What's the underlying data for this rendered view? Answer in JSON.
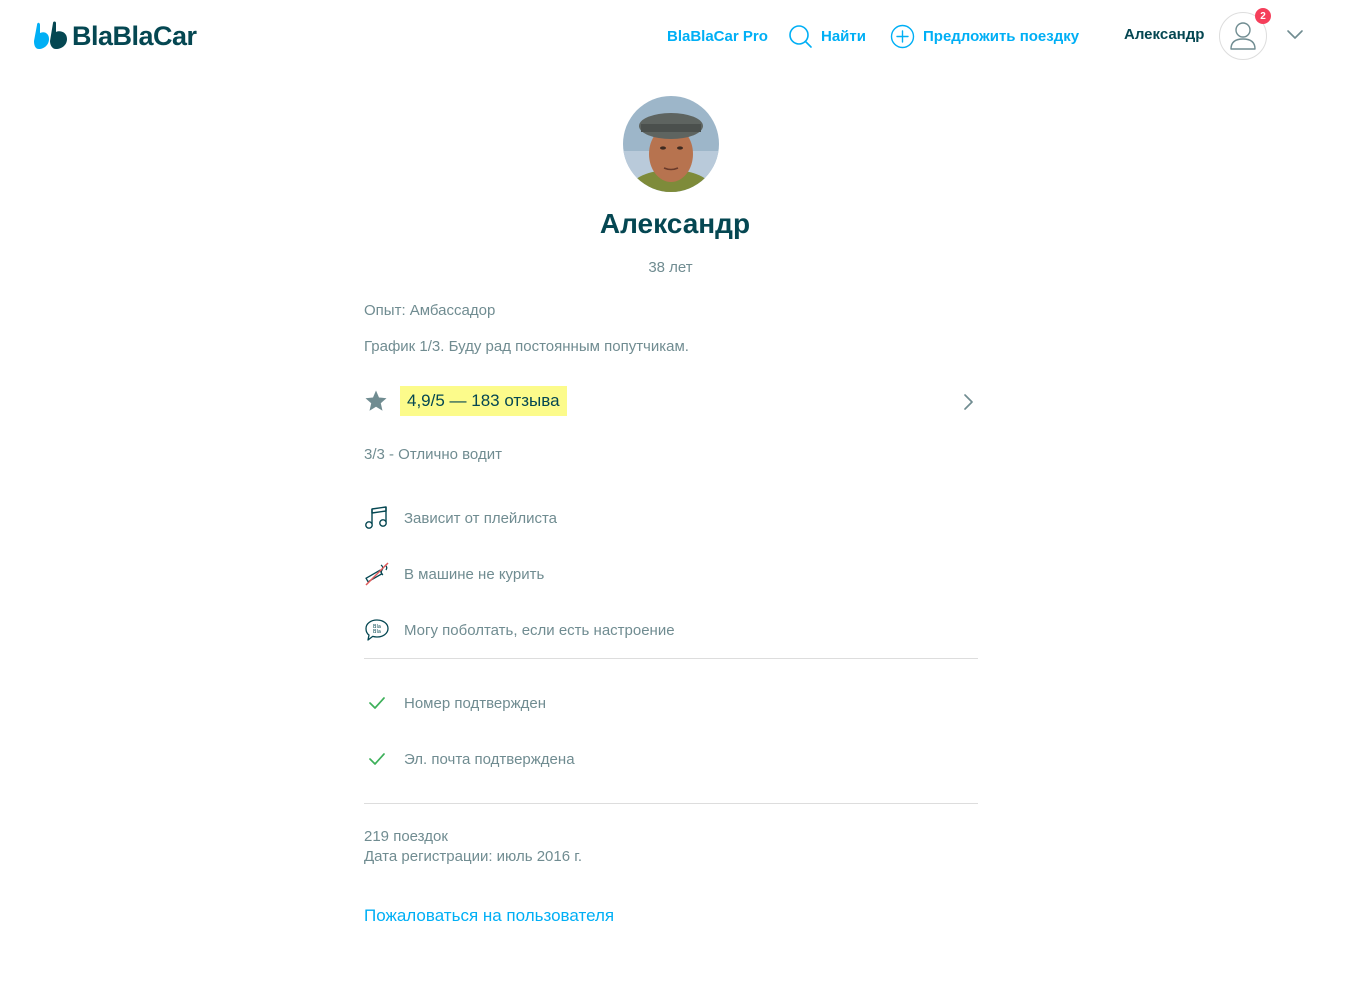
{
  "header": {
    "logo_text": "BlaBlaCar",
    "nav": {
      "pro_label": "BlaBlaCar Pro",
      "search_label": "Найти",
      "offer_label": "Предложить поездку"
    },
    "user_name": "Александр",
    "notification_count": "2"
  },
  "profile": {
    "name": "Александр",
    "age": "38 лет",
    "experience": "Опыт: Амбассадор",
    "bio": "График 1/3. Буду рад постоянным попутчикам.",
    "rating_text": "4,9/5 — 183 отзыва",
    "driving_skill": "3/3 - Отлично водит",
    "preferences": [
      {
        "icon": "music-icon",
        "label": "Зависит от плейлиста"
      },
      {
        "icon": "no-smoking-icon",
        "label": "В машине не курить"
      },
      {
        "icon": "chat-bubble-icon",
        "label": "Могу поболтать, если есть настроение"
      }
    ],
    "verifications": [
      {
        "icon": "check-icon",
        "label": "Номер подтвержден"
      },
      {
        "icon": "check-icon",
        "label": "Эл. почта подтверждена"
      }
    ],
    "rides_count": "219 поездок",
    "registration_date": "Дата регистрации: июль 2016 г.",
    "report_link": "Пожаловаться на пользователя"
  },
  "colors": {
    "brand_blue": "#00AFF5",
    "dark_teal": "#054752",
    "muted_text": "#708C91",
    "rating_highlight": "#FCFB8B",
    "check_green": "#3DB05A",
    "badge_red": "#F53F5B"
  }
}
